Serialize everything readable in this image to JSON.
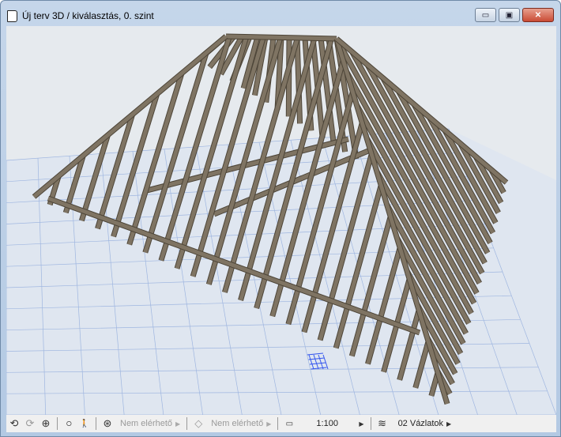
{
  "window": {
    "title": "Új terv 3D / kiválasztás, 0. szint",
    "minimize": "▭",
    "maximize": "▣",
    "close": "✕"
  },
  "toolbar": {
    "orbit": "⟲",
    "redo": "⟳",
    "zoom": "⊕",
    "lasso": "ဝ",
    "walk": "🚶",
    "explore": "⊛",
    "option1": "Nem elérhető",
    "option2": "Nem elérhető",
    "scale": "1:100",
    "layer": "02 Vázlatok"
  },
  "colors": {
    "timber": "#7f7463",
    "timber_edge": "#4d4538",
    "grid": "#9fb6e0",
    "plane": "#dfe6f0"
  }
}
